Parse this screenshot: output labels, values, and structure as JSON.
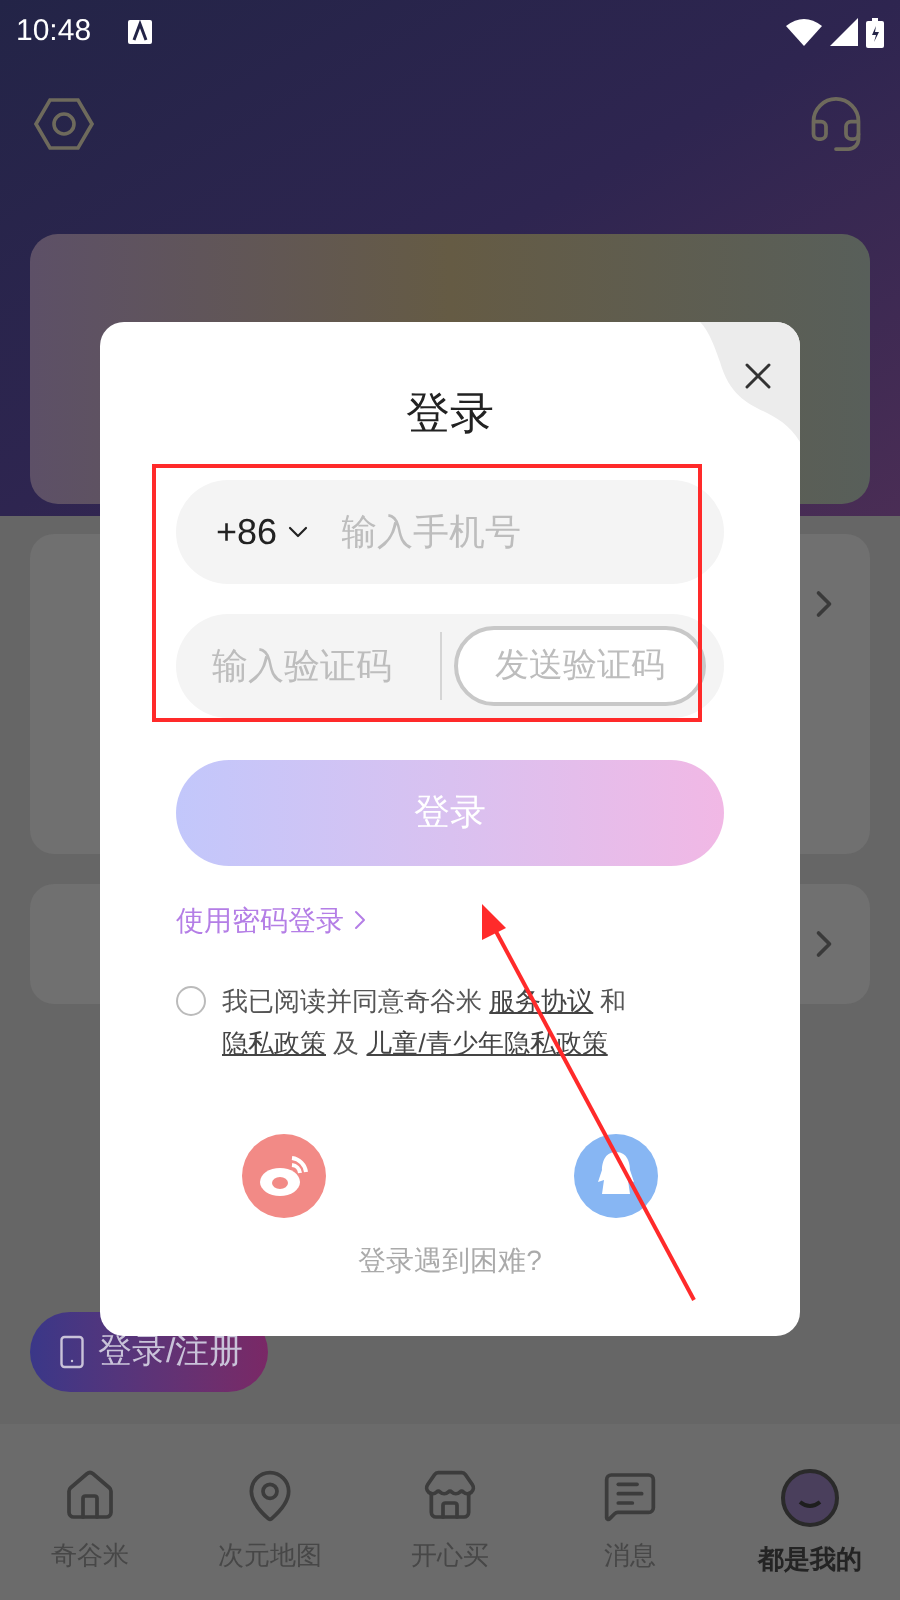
{
  "status_bar": {
    "time": "10:48"
  },
  "login_register_button": {
    "label": "登录/注册"
  },
  "bottom_nav": [
    {
      "label": "奇谷米",
      "kind": "home",
      "selected": false
    },
    {
      "label": "次元地图",
      "kind": "map",
      "selected": false
    },
    {
      "label": "开心买",
      "kind": "shop",
      "selected": false
    },
    {
      "label": "消息",
      "kind": "message",
      "selected": false
    },
    {
      "label": "都是我的",
      "kind": "avatar",
      "selected": true
    }
  ],
  "login_dialog": {
    "title": "登录",
    "phone": {
      "country_code": "+86",
      "placeholder": "输入手机号"
    },
    "code": {
      "placeholder": "输入验证码",
      "send_button": "发送验证码"
    },
    "login_button": "登录",
    "password_login_link": "使用密码登录",
    "agreement": {
      "checked": false,
      "parts": [
        {
          "text": "我已阅读并同意奇谷米 ",
          "link": false
        },
        {
          "text": "服务协议",
          "link": true
        },
        {
          "text": " 和 ",
          "link": false
        },
        {
          "text": "隐私政策",
          "link": true
        },
        {
          "text": " 及 ",
          "link": false
        },
        {
          "text": "儿童/青少年隐私政策",
          "link": true
        }
      ]
    },
    "social_login": [
      {
        "kind": "weibo"
      },
      {
        "kind": "qq"
      }
    ],
    "help_link": "登录遇到困难?"
  }
}
